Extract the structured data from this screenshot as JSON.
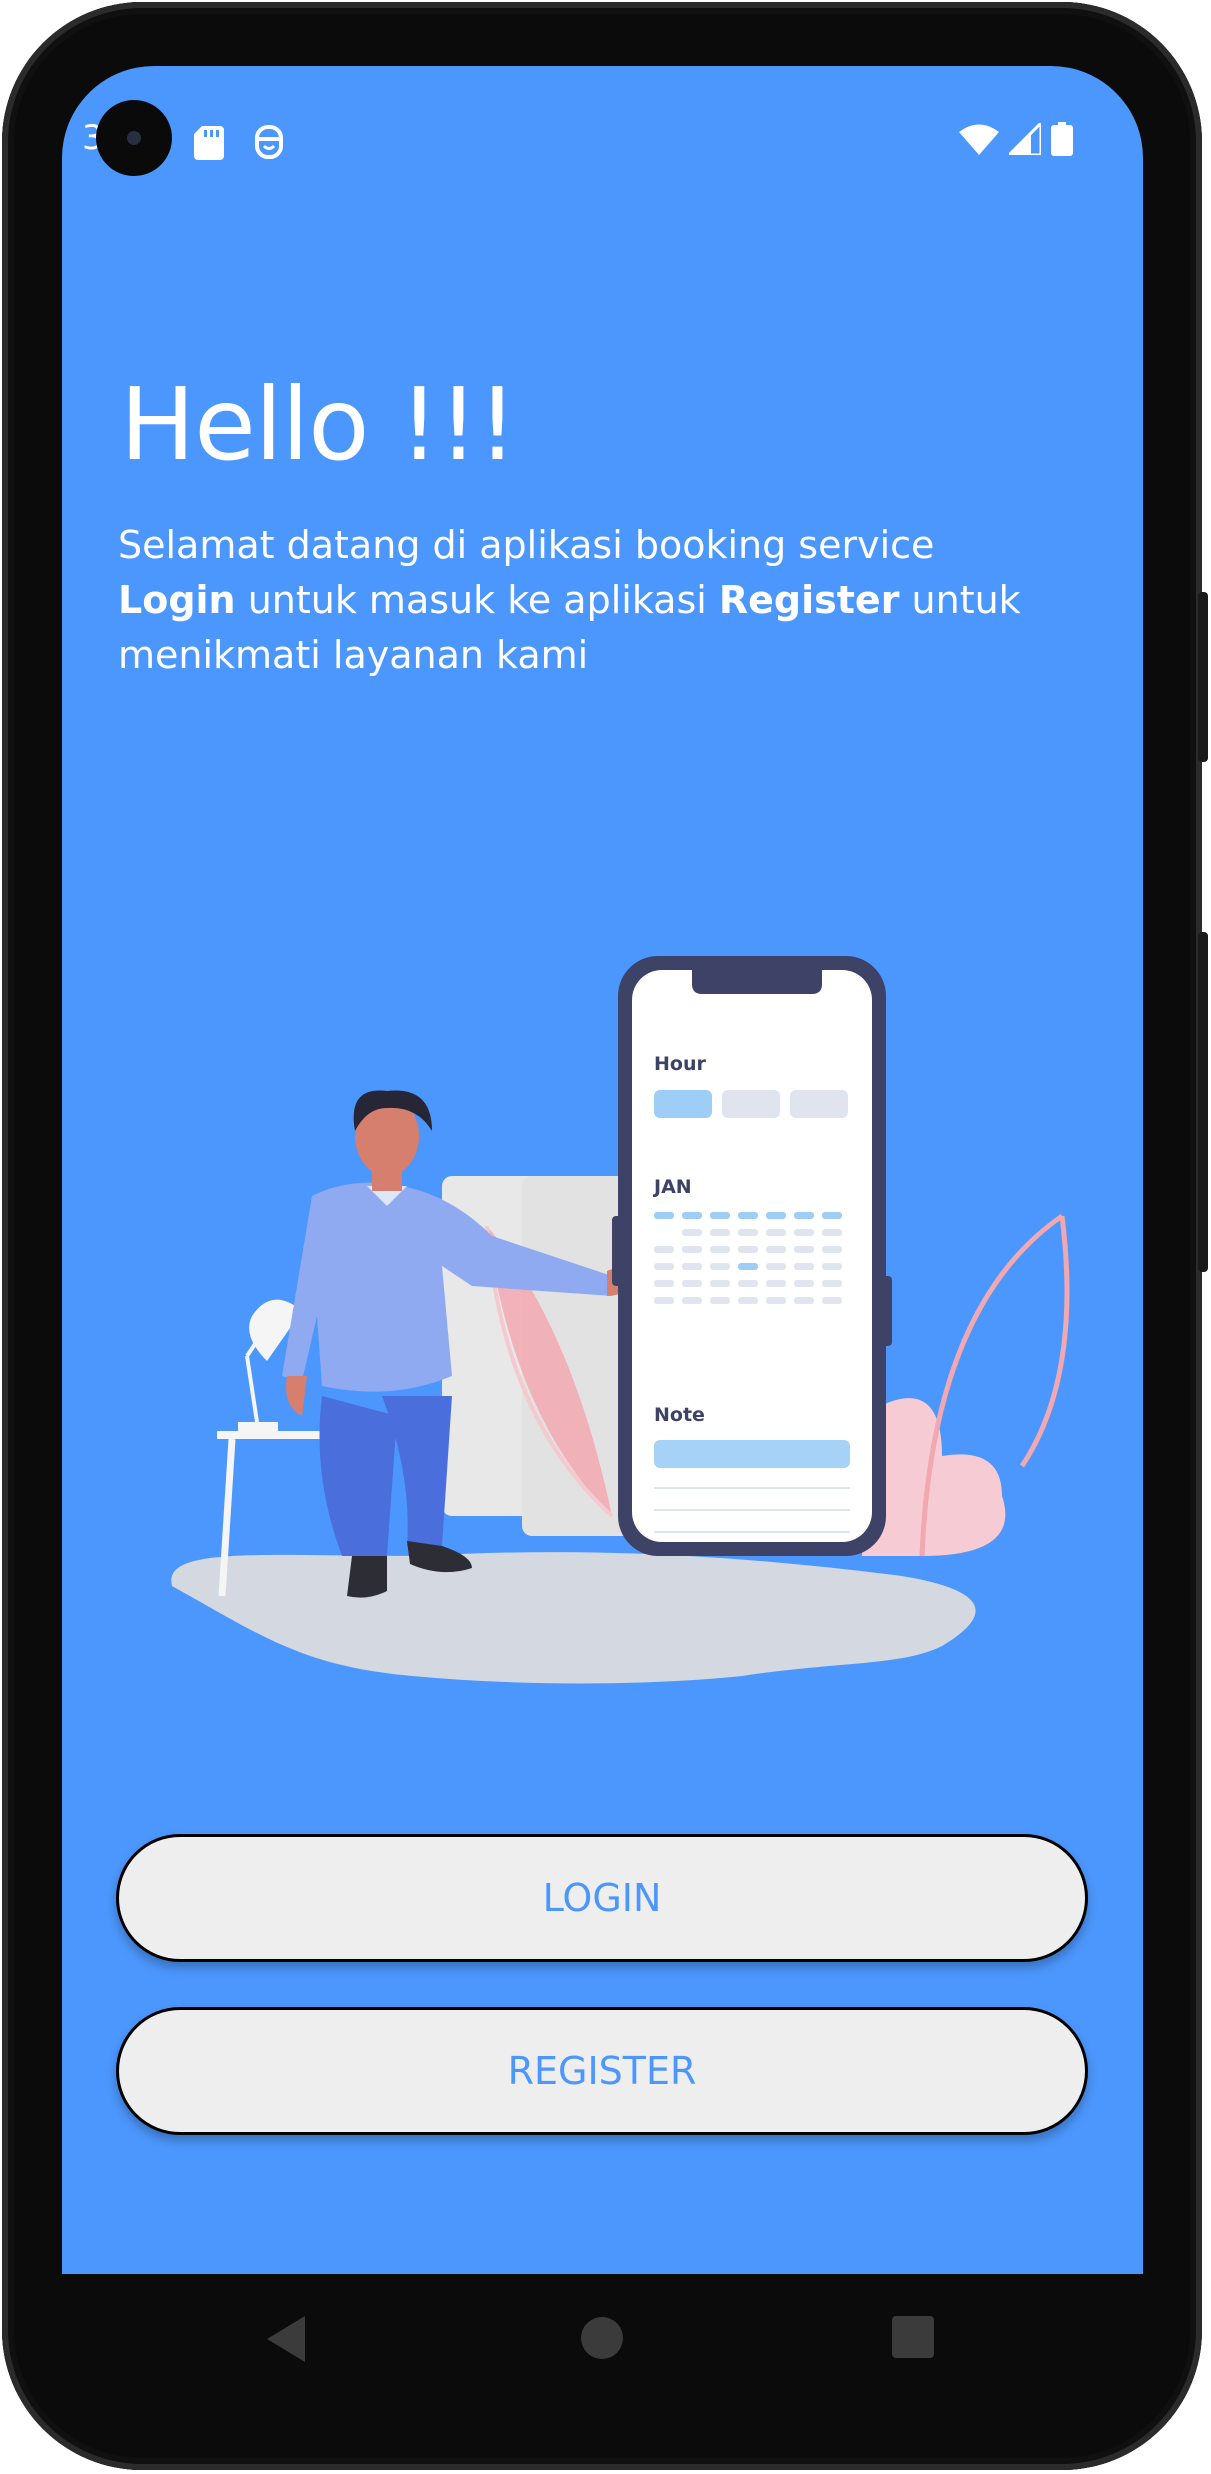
{
  "status_bar": {
    "left_text": "3",
    "icons": [
      "sd-card-icon",
      "smiley-icon",
      "wifi-icon",
      "signal-icon",
      "battery-icon"
    ]
  },
  "main": {
    "title": "Hello !!!",
    "welcome_line1": " Selamat datang di aplikasi booking service",
    "login_word": "Login",
    "welcome_mid": " untuk masuk ke aplikasi ",
    "register_word": "Register",
    "welcome_end": " untuk menikmati layanan kami"
  },
  "illustration": {
    "hour_label": "Hour",
    "month_label": "JAN",
    "note_label": "Note"
  },
  "buttons": {
    "login": "LOGIN",
    "register": "REGISTER"
  },
  "navigation": {
    "icons": [
      "back-icon",
      "home-icon",
      "recents-icon"
    ]
  },
  "colors": {
    "background": "#4c97fd",
    "button_bg": "#eeeeee",
    "button_text": "#4c97fd"
  }
}
